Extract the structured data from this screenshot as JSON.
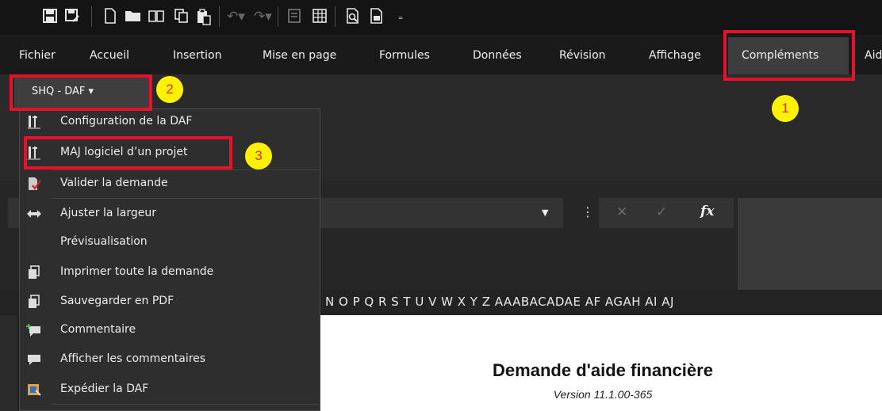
{
  "quick_access": {
    "icons": [
      "save-icon",
      "save-as-icon",
      "new-document-icon",
      "open-folder-icon",
      "book-icon",
      "copy-icon",
      "paste-icon",
      "undo-icon",
      "redo-icon",
      "form-icon",
      "table-icon",
      "print-preview-icon",
      "print-setup-icon",
      "customize-icon"
    ]
  },
  "ribbon_tabs": [
    "Fichier",
    "Accueil",
    "Insertion",
    "Mise en page",
    "Formules",
    "Données",
    "Révision",
    "Affichage",
    "Compléments",
    "Aid"
  ],
  "active_tab": "Compléments",
  "addin_button": {
    "label": "SHQ - DAF ▾"
  },
  "menu_items": [
    {
      "label": "Configuration de la DAF",
      "icon": "tools-icon"
    },
    {
      "label": "MAJ logiciel d’un projet",
      "icon": "tools-icon"
    },
    {
      "label": "Valider la demande",
      "icon": "validate-icon"
    },
    {
      "label": "Ajuster la largeur",
      "icon": "resize-width-icon"
    },
    {
      "label": "Prévisualisation",
      "icon": ""
    },
    {
      "label": "Imprimer toute la demande",
      "icon": "pages-icon"
    },
    {
      "label": "Sauvegarder en PDF",
      "icon": "pages-icon"
    },
    {
      "label": "Commentaire",
      "icon": "add-comment-icon"
    },
    {
      "label": "Afficher les commentaires",
      "icon": "comment-icon"
    },
    {
      "label": "Expédier la DAF",
      "icon": "send-icon"
    }
  ],
  "formula_bar": {
    "fx": "fx",
    "cancel": "✕",
    "enter": "✓"
  },
  "column_headers": "N O P Q R S T  U  V W X  Y  Z AAABACADAE  AF AGAH AI AJ",
  "sheet": {
    "title": "Demande d'aide financière",
    "version": "Version 11.1.00-365"
  },
  "annotations": [
    "1",
    "2",
    "3"
  ],
  "colors": {
    "highlight": "#e8112a",
    "badge": "#fff200",
    "badge_text": "#e0321c"
  }
}
